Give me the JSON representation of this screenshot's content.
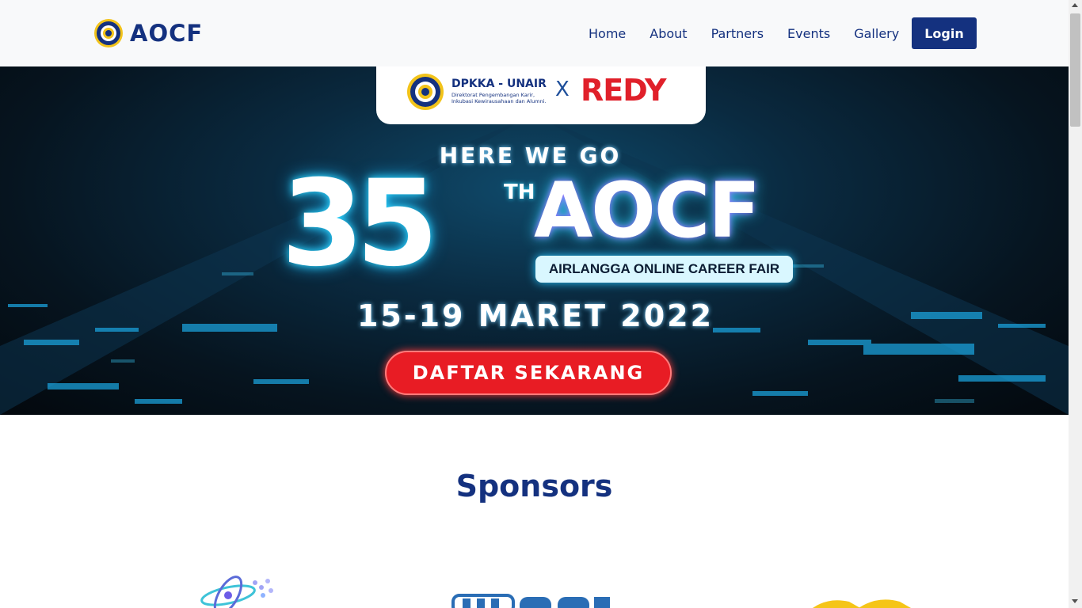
{
  "navbar": {
    "brand": "AOCF",
    "links": [
      "Home",
      "About",
      "Partners",
      "Events",
      "Gallery"
    ],
    "login_label": "Login"
  },
  "hero": {
    "partner_name": "DPKKA - UNAIR",
    "partner_sub": "Direktorat Pengembangan Karir, Inkubasi Kewirausahaan dan Alumni.",
    "partner_x": "X",
    "partner_redy": "REDY",
    "tagline": "HERE WE GO",
    "number": "35",
    "ordinal": "TH",
    "title": "AOCF",
    "subtitle": "AIRLANGGA ONLINE CAREER FAIR",
    "date": "15-19 MARET 2022",
    "cta": "DAFTAR SEKARANG"
  },
  "sponsors": {
    "title": "Sponsors"
  },
  "colors": {
    "primary": "#14317f",
    "cta": "#e81c24",
    "navbar_bg": "#f8f9fa",
    "logo_gold": "#f2c31a"
  }
}
